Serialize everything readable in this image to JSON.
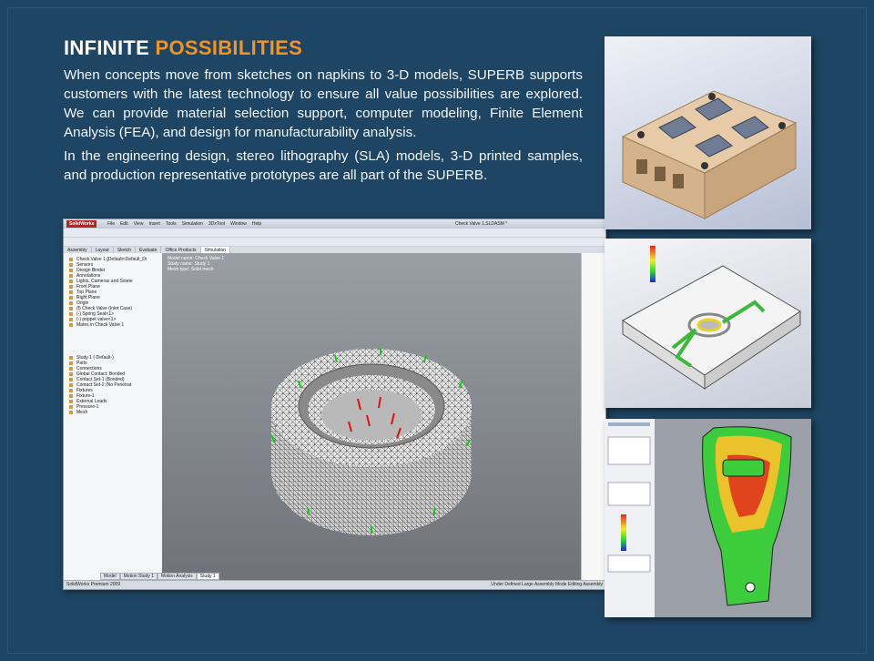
{
  "headline": {
    "part1": "INFINITE",
    "part2": "POSSIBILITIES"
  },
  "paragraphs": [
    "When concepts move from sketches on napkins to 3-D models, SUPERB supports customers with the latest technology to ensure all value possibilities are explored. We can provide material selection support, computer modeling, Finite Element Analysis (FEA), and design for manufacturability analysis.",
    "In the engineering design, stereo lithography (SLA) models, 3-D printed samples, and production representative prototypes are all part of the SUPERB."
  ],
  "colors": {
    "background": "#1e4563",
    "accent": "#f39422",
    "text": "#ffffff"
  },
  "cad": {
    "logo": "SolidWorks",
    "menu": [
      "File",
      "Edit",
      "View",
      "Insert",
      "Tools",
      "Simulation",
      "3DxTool",
      "Window",
      "Help"
    ],
    "doc_title": "Check Valve 1.SLDASM *",
    "tabs": [
      "Assembly",
      "Layout",
      "Sketch",
      "Evaluate",
      "Office Products",
      "Simulation"
    ],
    "tree": [
      "Check Valve 1 (Default<Default_Di",
      "Sensors",
      "Design Binder",
      "Annotations",
      "Lights, Cameras and Scene",
      "Front Plane",
      "Top Plane",
      "Right Plane",
      "Origin",
      "(f) Check Valve (Inlet Case)",
      "(-) Spring Seat<1>",
      "(-) poppet valve<1>",
      "Mates in Check Valve 1"
    ],
    "study_tree": [
      "Study 1 (-Default-)",
      "Parts",
      "Connections",
      "Global Contact: Bonded",
      "Contact Set-1 (Bonded)",
      "Contact Set-2 (No Penetrat",
      "Fixtures",
      "Fixture-1",
      "External Loads",
      "Pressure-1",
      "Mesh"
    ],
    "view_info": [
      "Model name: Check Valve 1",
      "Study name: Study 1",
      "Mesh type: Solid mesh"
    ],
    "bottom_tabs": [
      "Model",
      "Motion Study 1",
      "Motion Analysis",
      "Study 1"
    ],
    "status_left": "SolidWorks Premium 2009",
    "status_right": "Under Defined  Large Assembly Mode  Editing Assembly"
  }
}
